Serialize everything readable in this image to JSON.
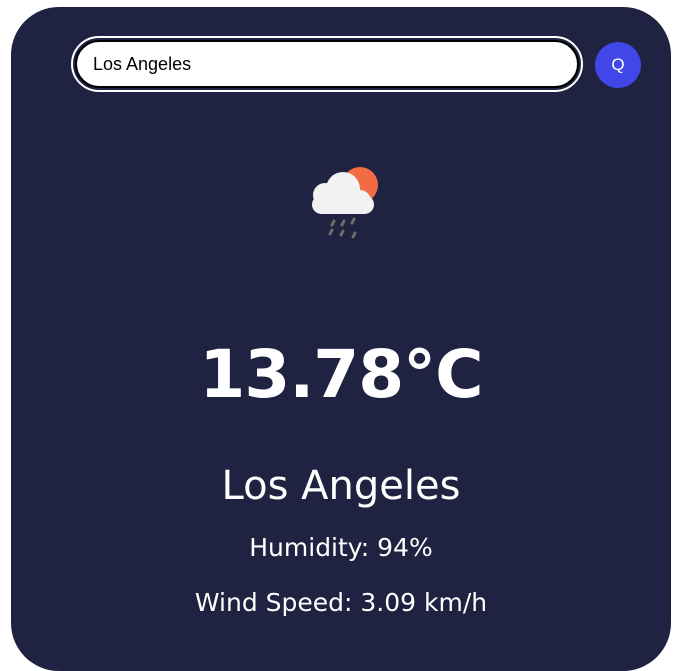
{
  "search": {
    "value": "Los Angeles",
    "button_label": "Q"
  },
  "weather": {
    "icon": "cloud-sun-rain-icon",
    "temperature": "13.78°C",
    "city": "Los Angeles",
    "humidity": "Humidity: 94%",
    "wind_speed": "Wind Speed: 3.09 km/h"
  },
  "colors": {
    "card_background": "#1f2240",
    "search_button": "#4046e8",
    "sun": "#f26b43",
    "cloud": "#f2f2f2",
    "rain": "#6c6c6c"
  }
}
